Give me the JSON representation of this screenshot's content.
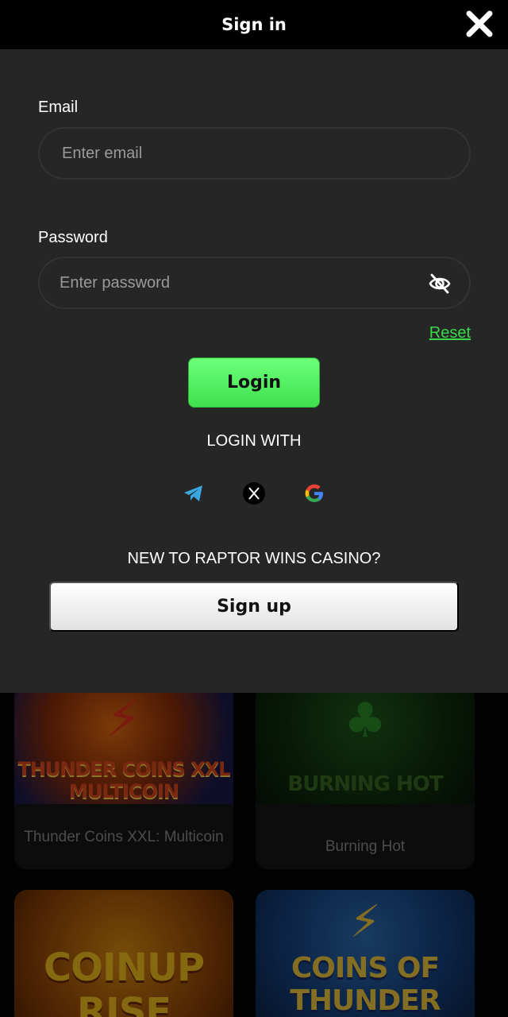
{
  "header": {
    "title": "Sign in",
    "close_icon": "close-icon"
  },
  "form": {
    "email_label": "Email",
    "email_placeholder": "Enter email",
    "password_label": "Password",
    "password_placeholder": "Enter password",
    "password_toggle_icon": "eye-slash-icon",
    "reset_label": "Reset",
    "login_label": "Login",
    "login_with_label": "LOGIN WITH",
    "social_icons": [
      "telegram-icon",
      "x-icon",
      "google-icon"
    ],
    "new_to_label": "NEW TO RAPTOR WINS CASINO?",
    "signup_label": "Sign up"
  },
  "games": [
    {
      "name": "Thunder Coins XXL: Multicoin",
      "art_text": "THUNDER COINS XXL MULTICOIN"
    },
    {
      "name": "Burning Hot",
      "art_text": "BURNING HOT"
    },
    {
      "name": "",
      "art_text": "COINUP RISE"
    },
    {
      "name": "",
      "art_text": "COINS OF THUNDER"
    }
  ],
  "colors": {
    "accent_green": "#3fe04f",
    "reset_link": "#39d94a",
    "panel_bg": "#262626",
    "header_bg": "#000000"
  }
}
